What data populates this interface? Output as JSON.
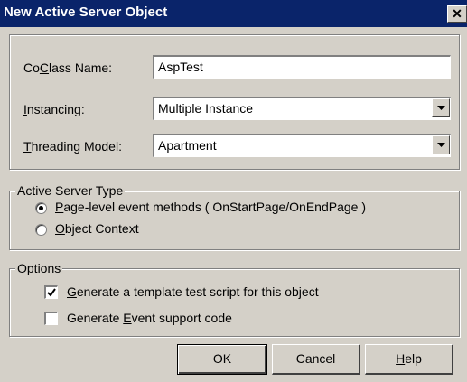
{
  "window": {
    "title": "New Active Server Object",
    "close_glyph": "✕"
  },
  "fields": {
    "coclass": {
      "label_pre": "Co",
      "label_key": "C",
      "label_post": "lass Name:",
      "value": "AspTest"
    },
    "instancing": {
      "label_pre": "",
      "label_key": "I",
      "label_post": "nstancing:",
      "value": "Multiple Instance"
    },
    "threading": {
      "label_pre": "",
      "label_key": "T",
      "label_post": "hreading Model:",
      "value": "Apartment"
    }
  },
  "server_type": {
    "legend": "Active Server Type",
    "options": [
      {
        "key": "P",
        "rest": "age-level event methods ( OnStartPage/OnEndPage )",
        "selected": true
      },
      {
        "key": "O",
        "rest": "bject Context",
        "selected": false
      }
    ]
  },
  "options": {
    "legend": "Options",
    "items": [
      {
        "pre": "",
        "key": "G",
        "rest": "enerate a template test script for this object",
        "checked": true
      },
      {
        "pre": "Generate ",
        "key": "E",
        "rest": "vent support code",
        "checked": false
      }
    ]
  },
  "buttons": {
    "ok": "OK",
    "cancel": "Cancel",
    "help_key": "H",
    "help_rest": "elp"
  },
  "icons": {
    "close": "close-icon",
    "dropdown": "chevron-down-icon",
    "checkmark": "checkmark-icon"
  }
}
